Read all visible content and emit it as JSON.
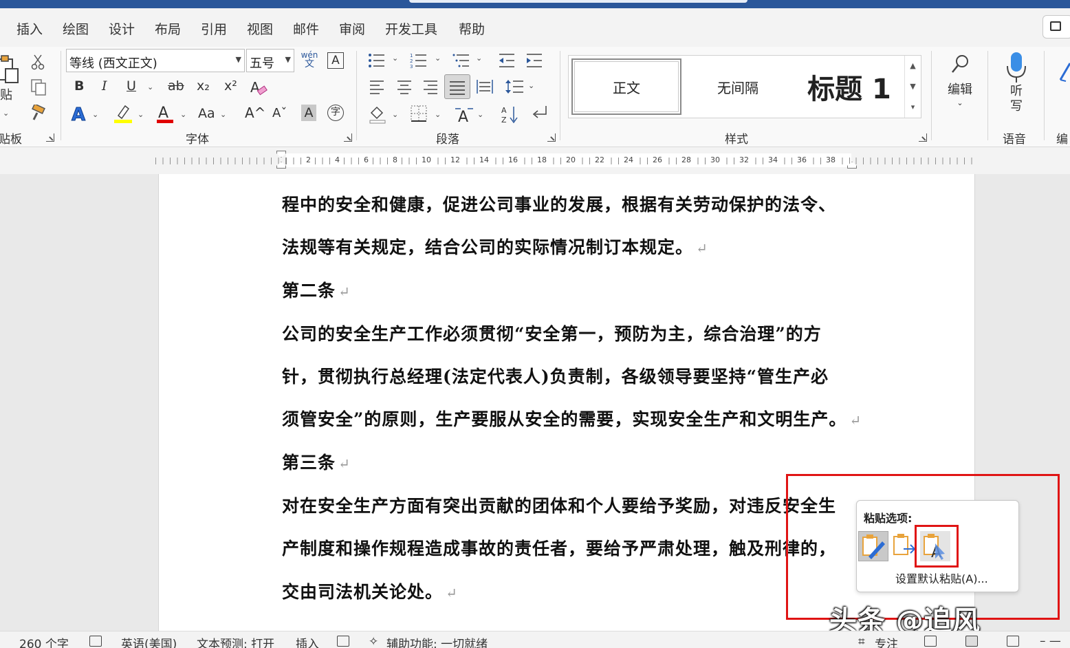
{
  "tabs": [
    "插入",
    "绘图",
    "设计",
    "布局",
    "引用",
    "视图",
    "邮件",
    "审阅",
    "开发工具",
    "帮助"
  ],
  "groups": {
    "clipboard": "贴板",
    "paste_label": "贴",
    "font": "字体",
    "paragraph": "段落",
    "styles": "样式",
    "voice": "语音",
    "editing_partial": "编"
  },
  "font": {
    "name": "等线 (西文正文)",
    "size": "五号",
    "phonetic_top": "wén",
    "phonetic_bottom": "文",
    "bold": "B",
    "italic": "I",
    "underline": "U",
    "strike": "ab",
    "subscript": "x₂",
    "superscript": "x²",
    "change_case": "Aa",
    "grow": "A^",
    "shrink": "Aˇ",
    "shade": "A",
    "enclose": "字"
  },
  "colors": {
    "highlight": "#ffff00",
    "font_color": "#e00000",
    "text_effect": "#2b6cd4",
    "accent": "#2b579a",
    "red_box": "#e01414"
  },
  "styles": [
    {
      "label": "正文"
    },
    {
      "label": "无间隔"
    },
    {
      "label": "标题 1"
    }
  ],
  "editing": {
    "label": "编辑"
  },
  "dictate": {
    "line1": "听",
    "line2": "写"
  },
  "ruler_numbers": [
    "2",
    "4",
    "6",
    "8",
    "10",
    "12",
    "14",
    "16",
    "18",
    "20",
    "22",
    "24",
    "26",
    "28",
    "30",
    "32",
    "34",
    "36",
    "38"
  ],
  "document": {
    "lines": [
      {
        "text": "程中的安全和健康，促进公司事业的发展，根据有关劳动保护的法令、",
        "mark": ""
      },
      {
        "text": "法规等有关规定，结合公司的实际情况制订本规定。",
        "mark": "↵"
      },
      {
        "text": "第二条",
        "mark": "↵"
      },
      {
        "text": "公司的安全生产工作必须贯彻“安全第一，预防为主，综合治理”的方",
        "mark": ""
      },
      {
        "text": "针，贯彻执行总经理(法定代表人)负责制，各级领导要坚持“管生产必",
        "mark": ""
      },
      {
        "text": "须管安全”的原则，生产要服从安全的需要，实现安全生产和文明生产。",
        "mark": "↵"
      },
      {
        "text": "第三条",
        "mark": "↵"
      },
      {
        "text": "对在安全生产方面有突出贡献的团体和个人要给予奖励，对违反安全生",
        "mark": ""
      },
      {
        "text": "产制度和操作规程造成事故的责任者，要给予严肃处理，触及刑律的，",
        "mark": ""
      },
      {
        "text": "交由司法机关论处。",
        "mark": "↵"
      }
    ]
  },
  "paste_options": {
    "title": "粘贴选项:",
    "options": [
      "keep-source-formatting",
      "merge-formatting",
      "keep-text-only"
    ],
    "default_link": "设置默认粘贴(A)..."
  },
  "watermark": "头条 @追风Office",
  "status": {
    "word_count": "260 个字",
    "language": "英语(美国)",
    "prediction": "文本预测: 打开",
    "mode": "插入",
    "accessibility": "辅助功能: 一切就绪",
    "focus": "专注"
  }
}
